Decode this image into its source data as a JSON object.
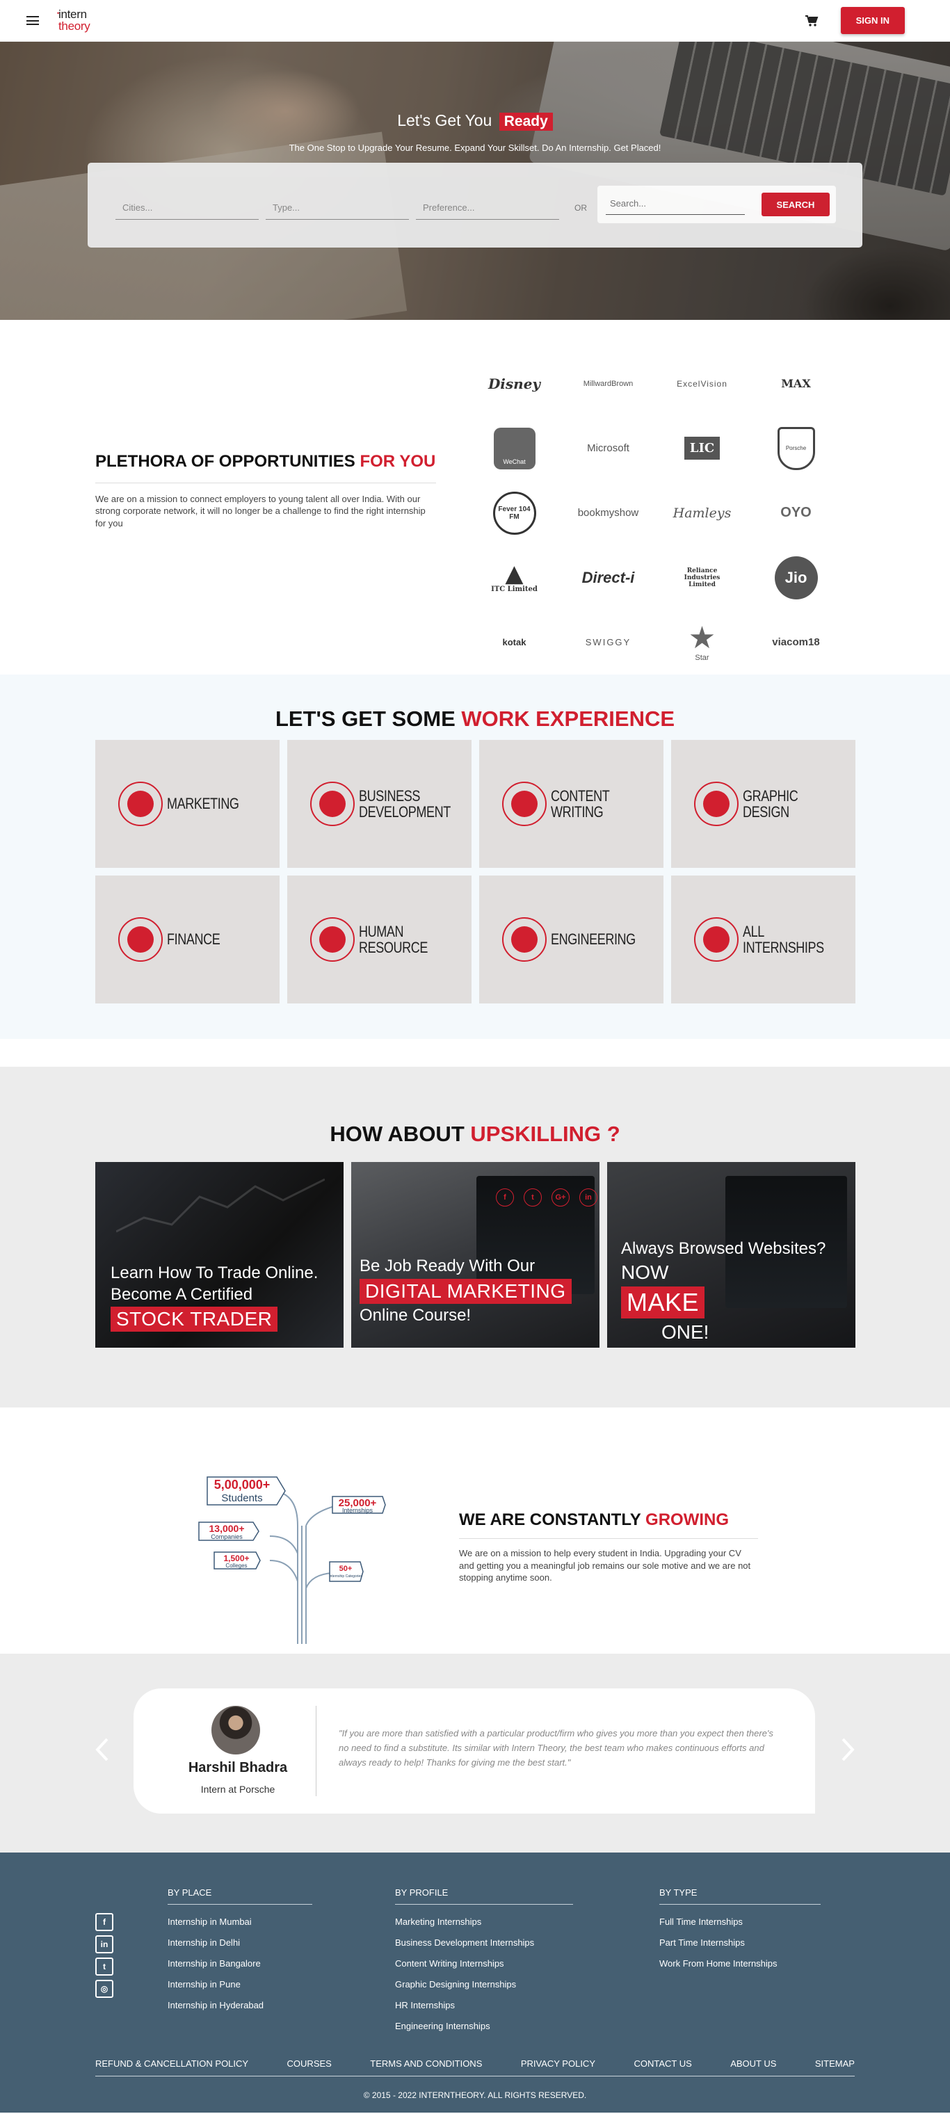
{
  "header": {
    "logo_line1": "intern",
    "logo_line2": "theory",
    "signin_label": "SIGN IN"
  },
  "hero": {
    "title_prefix": "Let's Get You",
    "title_highlight": "Ready",
    "subtitle": "The One Stop to Upgrade Your Resume. Expand Your Skillset. Do An Internship. Get Placed!",
    "fields": {
      "cities_placeholder": "Cities...",
      "type_placeholder": "Type...",
      "preference_placeholder": "Preference..."
    },
    "or_label": "OR",
    "search_placeholder": "Search...",
    "search_button": "SEARCH"
  },
  "plethora": {
    "title_prefix": "PLETHORA OF OPPORTUNITIES",
    "title_highlight": "FOR YOU",
    "text": "We are on a mission to connect employers to young talent all over India. With our strong corporate network, it will no longer be a challenge to find the right internship for you",
    "logos": [
      "Disney",
      "MillwardBrown",
      "ExcelVision",
      "MAX",
      "WeChat",
      "Microsoft",
      "LIC",
      "Porsche",
      "Fever 104 FM",
      "bookmyshow",
      "Hamleys",
      "OYO",
      "ITC Limited",
      "Direct-i",
      "Reliance Industries Limited",
      "Jio",
      "kotak",
      "SWIGGY",
      "Star",
      "viacom18"
    ]
  },
  "work": {
    "title_prefix": "LET'S GET SOME",
    "title_highlight": "WORK EXPERIENCE",
    "categories": [
      "MARKETING",
      "BUSINESS DEVELOPMENT",
      "CONTENT WRITING",
      "GRAPHIC DESIGN",
      "FINANCE",
      "HUMAN RESOURCE",
      "ENGINEERING",
      "ALL INTERNSHIPS"
    ]
  },
  "upskill": {
    "title_prefix": "HOW ABOUT",
    "title_highlight": "UPSKILLING ?",
    "card1": {
      "line1": "Learn How To Trade Online.",
      "line2": "Become A Certified",
      "highlight": "STOCK TRADER"
    },
    "card2": {
      "line1": "Be Job Ready With Our",
      "highlight": "DIGITAL MARKETING",
      "line2": "Online Course!"
    },
    "card3": {
      "line1": "Always Browsed Websites?",
      "line2": "NOW",
      "highlight": "MAKE",
      "line3": "ONE!"
    }
  },
  "growing": {
    "stats": [
      {
        "value": "5,00,000+",
        "label": "Students"
      },
      {
        "value": "25,000+",
        "label": "Internships"
      },
      {
        "value": "13,000+",
        "label": "Companies"
      },
      {
        "value": "1,500+",
        "label": "Colleges"
      },
      {
        "value": "50+",
        "label": "Internship Categories"
      }
    ],
    "title_prefix": "WE ARE CONSTANTLY",
    "title_highlight": "GROWING",
    "text": "We are on a mission to help every student in India. Upgrading your CV and getting you a meaningful job remains our sole motive and we are not stopping anytime soon."
  },
  "testimonial": {
    "name": "Harshil Bhadra",
    "role": "Intern at Porsche",
    "quote": "\"If you are more than satisfied with a particular product/firm who gives you more than you expect then there's no need to find a substitute. Its similar with Intern Theory, the best team who makes continuous efforts and always ready to help! Thanks for giving me the best start.\""
  },
  "footer": {
    "by_place": {
      "heading": "BY PLACE",
      "links": [
        "Internship in Mumbai",
        "Internship in Delhi",
        "Internship in Bangalore",
        "Internship in Pune",
        "Internship in Hyderabad"
      ]
    },
    "by_profile": {
      "heading": "BY PROFILE",
      "links": [
        "Marketing Internships",
        "Business Development Internships",
        "Content Writing Internships",
        "Graphic Designing Internships",
        "HR Internships",
        "Engineering Internships"
      ]
    },
    "by_type": {
      "heading": "BY TYPE",
      "links": [
        "Full Time Internships",
        "Part Time Internships",
        "Work From Home Internships"
      ]
    },
    "bottom_links": [
      "REFUND & CANCELLATION POLICY",
      "COURSES",
      "TERMS AND CONDITIONS",
      "PRIVACY POLICY",
      "CONTACT US",
      "ABOUT US",
      "SITEMAP"
    ],
    "copyright": "© 2015 - 2022 INTERNTHEORY. ALL RIGHTS RESERVED."
  },
  "colors": {
    "accent": "#d11f2f",
    "footer_bg": "#455f72",
    "tile_bg": "#e1dedd"
  }
}
